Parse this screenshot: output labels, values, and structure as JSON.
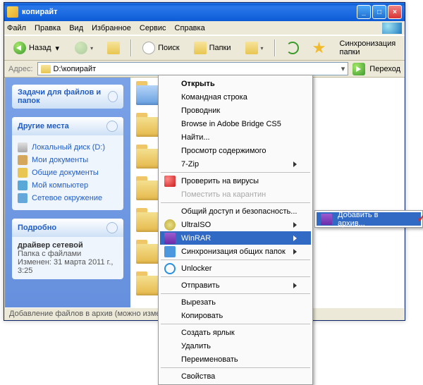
{
  "titlebar": {
    "title": "копирайт"
  },
  "menubar": {
    "items": [
      "Файл",
      "Правка",
      "Вид",
      "Избранное",
      "Сервис",
      "Справка"
    ]
  },
  "toolbar": {
    "back": "Назад",
    "search": "Поиск",
    "folders": "Папки",
    "sync": "Синхронизация папки"
  },
  "address": {
    "label": "Адрес:",
    "value": "D:\\копирайт",
    "go": "Переход"
  },
  "leftpane": {
    "tasks_hdr": "Задачи для файлов и папок",
    "places_hdr": "Другие места",
    "places": [
      {
        "label": "Локальный диск (D:)"
      },
      {
        "label": "Мои документы"
      },
      {
        "label": "Общие документы"
      },
      {
        "label": "Мой компьютер"
      },
      {
        "label": "Сетевое окружение"
      }
    ],
    "details_hdr": "Подробно",
    "details": {
      "name": "драйвер сетевой",
      "type": "Папка с файлами",
      "mod": "Изменен: 31 марта 2011 г., 3:25"
    }
  },
  "statusbar": "Добавление файлов в архив (можно изменить дополни",
  "context": {
    "items": [
      {
        "label": "Открыть",
        "bold": true
      },
      {
        "label": "Командная строка"
      },
      {
        "label": "Проводник"
      },
      {
        "label": "Browse in Adobe Bridge CS5"
      },
      {
        "label": "Найти..."
      },
      {
        "label": "Просмотр содержимого"
      },
      {
        "label": "7-Zip",
        "arrow": true
      },
      "sep",
      {
        "label": "Проверить на вирусы",
        "icon": "kav"
      },
      {
        "label": "Поместить на карантин",
        "disabled": true
      },
      "sep",
      {
        "label": "Общий доступ и безопасность..."
      },
      {
        "label": "UltraISO",
        "icon": "ui",
        "arrow": true
      },
      {
        "label": "WinRAR",
        "icon": "rar",
        "arrow": true,
        "hover": true
      },
      {
        "label": "Синхронизация общих папок",
        "icon": "syn",
        "arrow": true
      },
      "sep",
      {
        "label": "Unlocker",
        "icon": "unl"
      },
      "sep",
      {
        "label": "Отправить",
        "arrow": true
      },
      "sep",
      {
        "label": "Вырезать"
      },
      {
        "label": "Копировать"
      },
      "sep",
      {
        "label": "Создать ярлык"
      },
      {
        "label": "Удалить"
      },
      {
        "label": "Переименовать"
      },
      "sep",
      {
        "label": "Свойства"
      }
    ]
  },
  "submenu": {
    "item": "Добавить в архив..."
  }
}
